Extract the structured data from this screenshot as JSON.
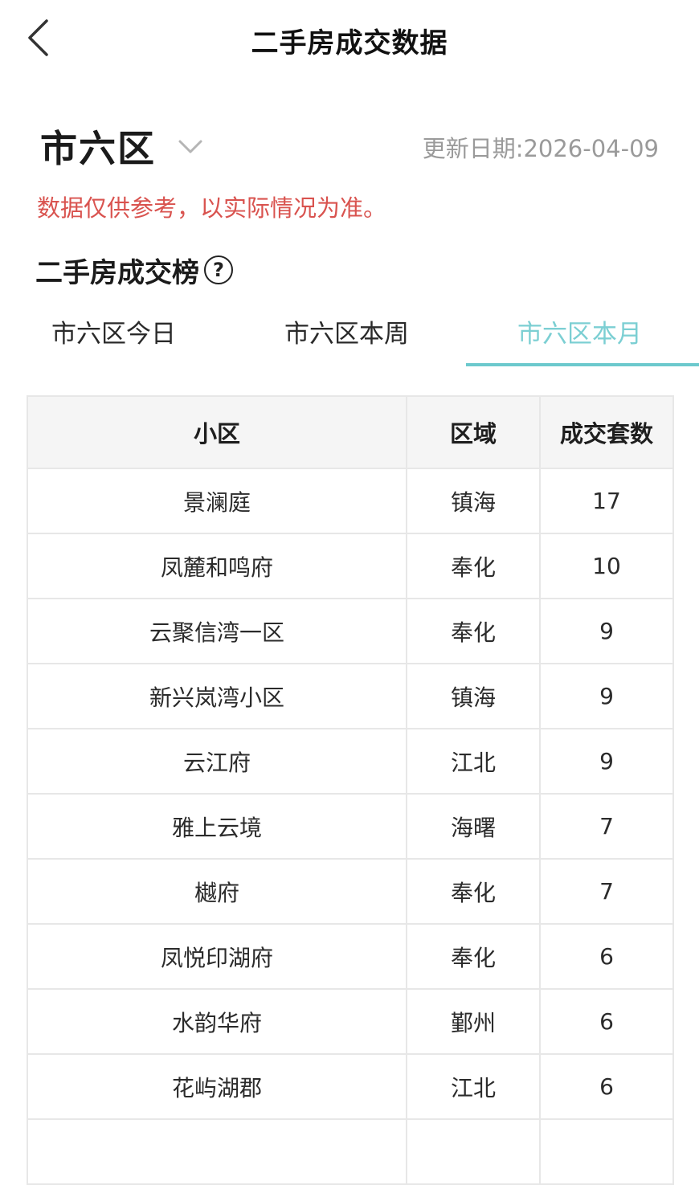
{
  "header": {
    "title": "二手房成交数据"
  },
  "region": {
    "name": "市六区",
    "update_label": "更新日期:2026-04-09"
  },
  "disclaimer": "数据仅供参考，以实际情况为准。",
  "section": {
    "title": "二手房成交榜",
    "help_glyph": "?"
  },
  "tabs": [
    {
      "label": "市六区今日",
      "active": false
    },
    {
      "label": "市六区本周",
      "active": false
    },
    {
      "label": "市六区本月",
      "active": true
    }
  ],
  "table": {
    "headers": [
      "小区",
      "区域",
      "成交套数"
    ],
    "rows": [
      {
        "name": "景澜庭",
        "area": "镇海",
        "count": "17"
      },
      {
        "name": "凤麓和鸣府",
        "area": "奉化",
        "count": "10"
      },
      {
        "name": "云聚信湾一区",
        "area": "奉化",
        "count": "9"
      },
      {
        "name": "新兴岚湾小区",
        "area": "镇海",
        "count": "9"
      },
      {
        "name": "云江府",
        "area": "江北",
        "count": "9"
      },
      {
        "name": "雅上云境",
        "area": "海曙",
        "count": "7"
      },
      {
        "name": "樾府",
        "area": "奉化",
        "count": "7"
      },
      {
        "name": "凤悦印湖府",
        "area": "奉化",
        "count": "6"
      },
      {
        "name": "水韵华府",
        "area": "鄞州",
        "count": "6"
      },
      {
        "name": "花屿湖郡",
        "area": "江北",
        "count": "6"
      },
      {
        "name": "",
        "area": "",
        "count": ""
      }
    ]
  },
  "colors": {
    "accent": "#6cc9cd",
    "warning": "#d9534f",
    "muted": "#9a9a9a",
    "header_bg": "#f5f5f5"
  },
  "icons": {
    "back": "chevron-left-icon",
    "region_dropdown": "chevron-down-icon",
    "help": "help-circle-icon"
  }
}
